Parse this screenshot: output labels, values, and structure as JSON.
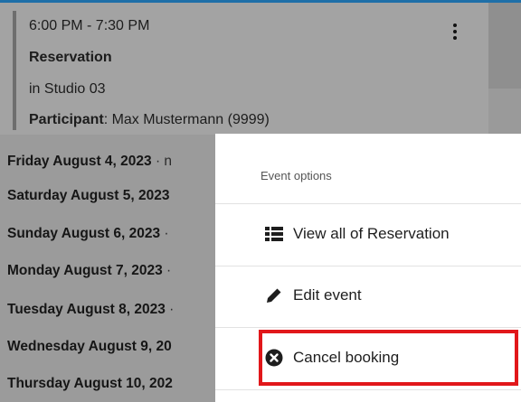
{
  "event": {
    "time": "6:00 PM - 7:30 PM",
    "title": "Reservation",
    "location": "in Studio 03",
    "participant_label": "Participant",
    "participant_value": ": Max Mustermann (9999)"
  },
  "days": [
    {
      "label": "Friday August 4, 2023",
      "suffix": " · n"
    },
    {
      "label": "Saturday August 5, 2023",
      "suffix": ""
    },
    {
      "label": "Sunday August 6, 2023",
      "suffix": " ·"
    },
    {
      "label": "Monday August 7, 2023",
      "suffix": " ·"
    },
    {
      "label": "Tuesday August 8, 2023",
      "suffix": " ·"
    },
    {
      "label": "Wednesday August 9, 20",
      "suffix": ""
    },
    {
      "label": "Thursday August 10, 202",
      "suffix": ""
    }
  ],
  "popup": {
    "header": "Event options",
    "items": [
      {
        "label": "View all of Reservation",
        "icon": "list-icon"
      },
      {
        "label": "Edit event",
        "icon": "pencil-icon"
      },
      {
        "label": "Cancel booking",
        "icon": "x-circle-icon"
      }
    ]
  },
  "colors": {
    "highlight": "#e1171a",
    "accent": "#1e6fa8"
  }
}
